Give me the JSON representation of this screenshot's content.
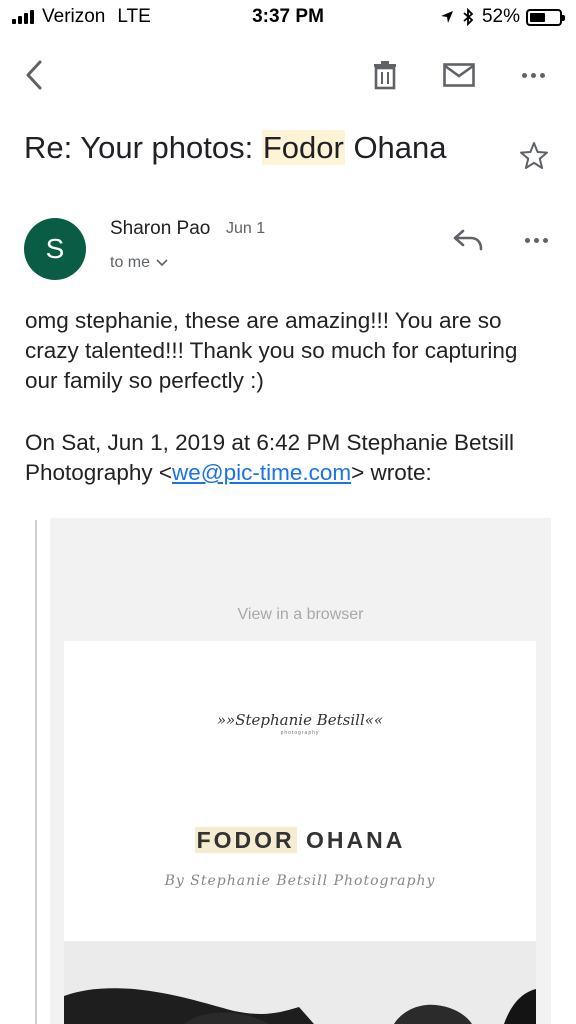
{
  "status_bar": {
    "carrier": "Verizon",
    "network": "LTE",
    "time": "3:37 PM",
    "battery_percent": "52%",
    "battery_level": 0.52
  },
  "toolbar": {
    "icons": [
      "back-icon",
      "trash-icon",
      "mail-icon",
      "more-icon"
    ]
  },
  "email": {
    "subject_prefix": "Re: Your photos: ",
    "subject_highlight": "Fodor",
    "subject_suffix": " Ohana",
    "sender": {
      "initial": "S",
      "name": "Sharon Pao",
      "date": "Jun 1",
      "recipient": "to me",
      "avatar_color": "#0b5c45"
    },
    "body": "omg stephanie, these are amazing!!! You are so crazy talented!!! Thank you so much for capturing our family so perfectly :)",
    "quote_intro_prefix": "On Sat, Jun 1, 2019 at 6:42 PM Stephanie Betsill Photography <",
    "quote_email": "we@pic-time.com",
    "quote_intro_suffix": "> wrote:",
    "quoted": {
      "view_in_browser": "View in a browser",
      "logo_text": "Stephanie Betsill",
      "logo_subtext": "photography",
      "gallery_title_highlight": "FODOR",
      "gallery_title_rest": " OHANA",
      "gallery_byline": "By Stephanie Betsill Photography"
    }
  },
  "colors": {
    "accent_link": "#1a73e8",
    "highlight": "#fdf3d7",
    "icon_gray": "#5f6368"
  }
}
